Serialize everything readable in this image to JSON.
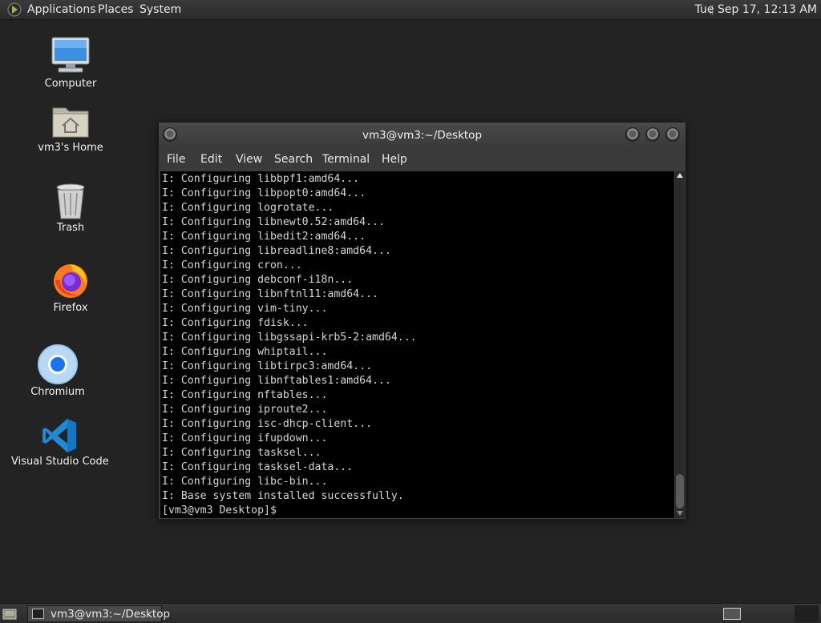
{
  "top_panel": {
    "menus": [
      "Applications",
      "Places",
      "System"
    ],
    "clock": "Tue Sep 17, 12:13 AM"
  },
  "desktop_icons": [
    {
      "label": "Computer",
      "icon": "computer-icon"
    },
    {
      "label": "vm3's Home",
      "icon": "home-folder-icon"
    },
    {
      "label": "Trash",
      "icon": "trash-icon"
    },
    {
      "label": "Firefox",
      "icon": "firefox-icon"
    },
    {
      "label": "Chromium",
      "icon": "chromium-icon"
    },
    {
      "label": "Visual Studio Code",
      "icon": "vscode-icon"
    }
  ],
  "terminal": {
    "title": "vm3@vm3:~/Desktop",
    "menu": [
      "File",
      "Edit",
      "View",
      "Search",
      "Terminal",
      "Help"
    ],
    "lines": [
      "I: Configuring libbpf1:amd64...",
      "I: Configuring libpopt0:amd64...",
      "I: Configuring logrotate...",
      "I: Configuring libnewt0.52:amd64...",
      "I: Configuring libedit2:amd64...",
      "I: Configuring libreadline8:amd64...",
      "I: Configuring cron...",
      "I: Configuring debconf-i18n...",
      "I: Configuring libnftnl11:amd64...",
      "I: Configuring vim-tiny...",
      "I: Configuring fdisk...",
      "I: Configuring libgssapi-krb5-2:amd64...",
      "I: Configuring whiptail...",
      "I: Configuring libtirpc3:amd64...",
      "I: Configuring libnftables1:amd64...",
      "I: Configuring nftables...",
      "I: Configuring iproute2...",
      "I: Configuring isc-dhcp-client...",
      "I: Configuring ifupdown...",
      "I: Configuring tasksel...",
      "I: Configuring tasksel-data...",
      "I: Configuring libc-bin...",
      "I: Base system installed successfully.",
      "[vm3@vm3 Desktop]$"
    ]
  },
  "taskbar": {
    "items": [
      {
        "label": "vm3@vm3:~/Desktop"
      }
    ]
  },
  "colors": {
    "desktop_bg": "#232323",
    "terminal_bg": "#000000",
    "terminal_fg": "#d6d6d6"
  }
}
